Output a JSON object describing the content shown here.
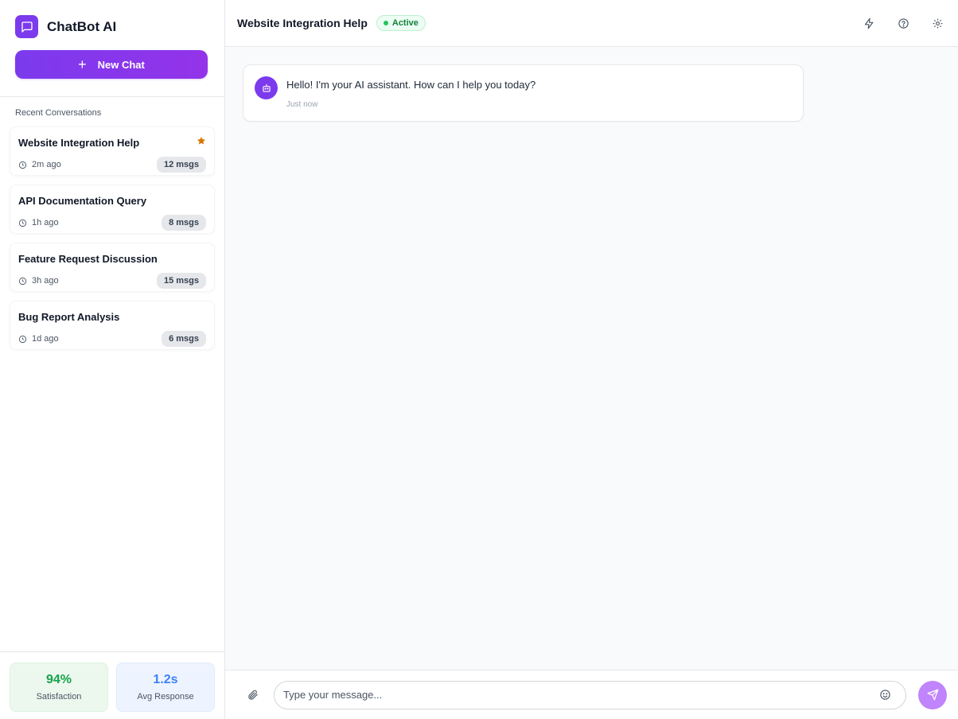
{
  "app": {
    "name": "ChatBot AI",
    "logo_icon": "chat-bubble-icon",
    "accent": "#7c3aed"
  },
  "sidebar": {
    "new_chat_label": "New Chat",
    "recent_heading": "Recent Conversations",
    "conversations": [
      {
        "title": "Website Integration Help",
        "time": "2m ago",
        "count": "12 msgs",
        "starred": true
      },
      {
        "title": "API Documentation Query",
        "time": "1h ago",
        "count": "8 msgs",
        "starred": false
      },
      {
        "title": "Feature Request Discussion",
        "time": "3h ago",
        "count": "15 msgs",
        "starred": false
      },
      {
        "title": "Bug Report Analysis",
        "time": "1d ago",
        "count": "6 msgs",
        "starred": false
      }
    ],
    "stats": [
      {
        "value": "94%",
        "label": "Satisfaction",
        "color": "#16a34a"
      },
      {
        "value": "1.2s",
        "label": "Avg Response",
        "color": "#3b82f6"
      }
    ]
  },
  "header": {
    "title": "Website Integration Help",
    "status": "Active",
    "status_color": "#22c55e",
    "actions": [
      "lightning-icon",
      "help-icon",
      "settings-icon"
    ]
  },
  "messages": [
    {
      "sender": "bot",
      "text": "Hello! I'm your AI assistant. How can I help you today?",
      "time": "Just now"
    }
  ],
  "composer": {
    "placeholder": "Type your message...",
    "value": ""
  }
}
